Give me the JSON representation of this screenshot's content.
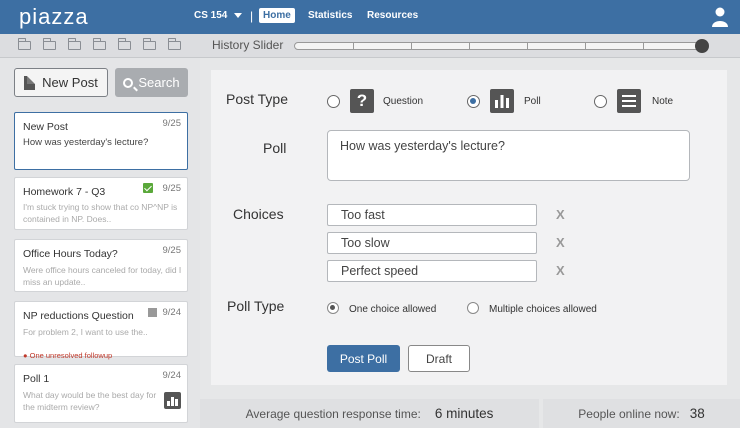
{
  "header": {
    "logo": "piazza",
    "course": "CS 154",
    "separator": "|",
    "nav": [
      {
        "label": "Home",
        "active": true
      },
      {
        "label": "Statistics",
        "active": false
      },
      {
        "label": "Resources",
        "active": false
      }
    ],
    "user_icon": "user-icon",
    "bar_color": "#3d6fa3"
  },
  "history": {
    "folder_icon": "folder-icon",
    "folder_count": 7,
    "label": "History Slider",
    "slider_value": 1.0
  },
  "sidebar": {
    "new_post_label": "New Post",
    "search_label": "Search",
    "posts": [
      {
        "title": "New Post",
        "date": "9/25",
        "body": "How was yesterday's lecture?",
        "selected": true
      },
      {
        "title": "Homework 7 - Q3",
        "date": "9/25",
        "body": "I'm stuck trying to show that co NP^NP is contained in NP.  Does..",
        "badge": "check-icon"
      },
      {
        "title": "Office Hours Today?",
        "date": "9/25",
        "body": "Were office hours canceled for today, did I miss an update.."
      },
      {
        "title": "NP reductions Question",
        "date": "9/24",
        "body": "For problem 2, I want to use the..",
        "followup": "One unresolved followup",
        "badge": "note-icon"
      },
      {
        "title": "Poll 1",
        "date": "9/24",
        "body": "What day would be the best day for the midterm review?",
        "badge": "poll-icon"
      }
    ]
  },
  "composer": {
    "post_type_label": "Post Type",
    "post_types": [
      {
        "label": "Question",
        "icon": "question-icon",
        "selected": false
      },
      {
        "label": "Poll",
        "icon": "poll-icon",
        "selected": true
      },
      {
        "label": "Note",
        "icon": "note-icon",
        "selected": false
      }
    ],
    "poll_label": "Poll",
    "poll_text": "How was yesterday's lecture?",
    "choices_label": "Choices",
    "choices": [
      "Too fast",
      "Too slow",
      "Perfect speed"
    ],
    "remove_label": "X",
    "poll_type_label": "Poll Type",
    "poll_type_options": [
      {
        "label": "One choice allowed",
        "selected": true
      },
      {
        "label": "Multiple choices allowed",
        "selected": false
      }
    ],
    "submit_label": "Post Poll",
    "draft_label": "Draft"
  },
  "footer": {
    "response_label": "Average question response time:",
    "response_value": "6 minutes",
    "online_label": "People online now:",
    "online_value": "38"
  }
}
